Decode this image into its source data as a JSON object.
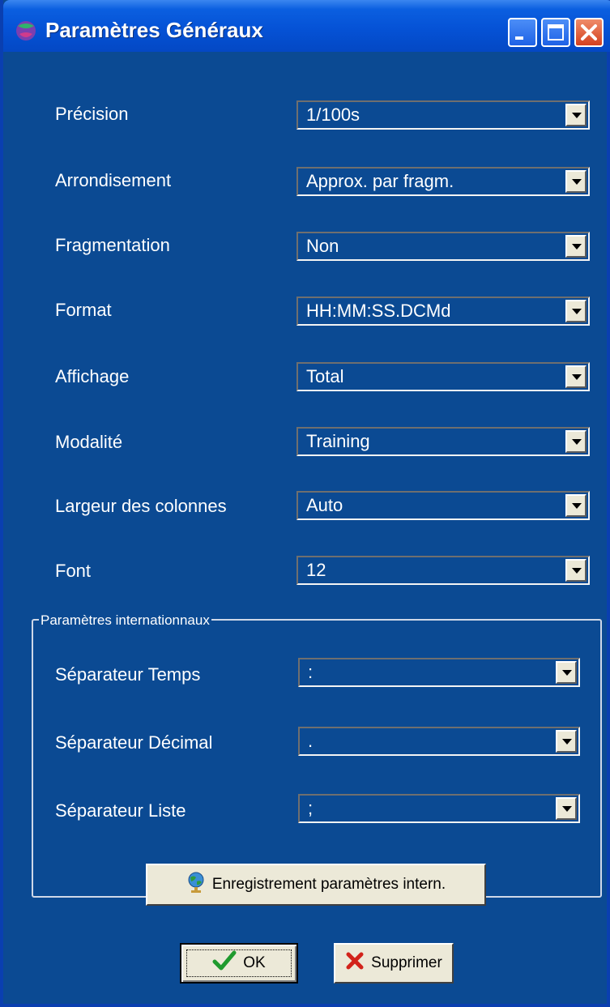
{
  "window": {
    "title": "Paramètres Généraux",
    "controls": {
      "minimize": "minimize-icon",
      "maximize": "maximize-icon",
      "close": "close-icon"
    }
  },
  "settings": [
    {
      "label": "Précision",
      "value": "1/100s"
    },
    {
      "label": "Arrondisement",
      "value": "Approx. par fragm."
    },
    {
      "label": "Fragmentation",
      "value": "Non"
    },
    {
      "label": "Format",
      "value": "HH:MM:SS.DCMd"
    },
    {
      "label": "Affichage",
      "value": "Total"
    },
    {
      "label": "Modalité",
      "value": "Training"
    },
    {
      "label": "Largeur des colonnes",
      "value": "Auto"
    },
    {
      "label": "Font",
      "value": "12"
    }
  ],
  "international": {
    "legend": "Paramètres internationnaux",
    "fields": [
      {
        "label": "Séparateur Temps",
        "value": ":"
      },
      {
        "label": "Séparateur Décimal",
        "value": "."
      },
      {
        "label": "Séparateur Liste",
        "value": ";"
      }
    ],
    "save_button": "Enregistrement paramètres intern."
  },
  "footer": {
    "ok_label": "OK",
    "delete_label": "Supprimer"
  },
  "colors": {
    "background": "#0b4a93",
    "titlebar": "#0552d6",
    "button_face": "#ece9d8",
    "text": "#ffffff"
  }
}
